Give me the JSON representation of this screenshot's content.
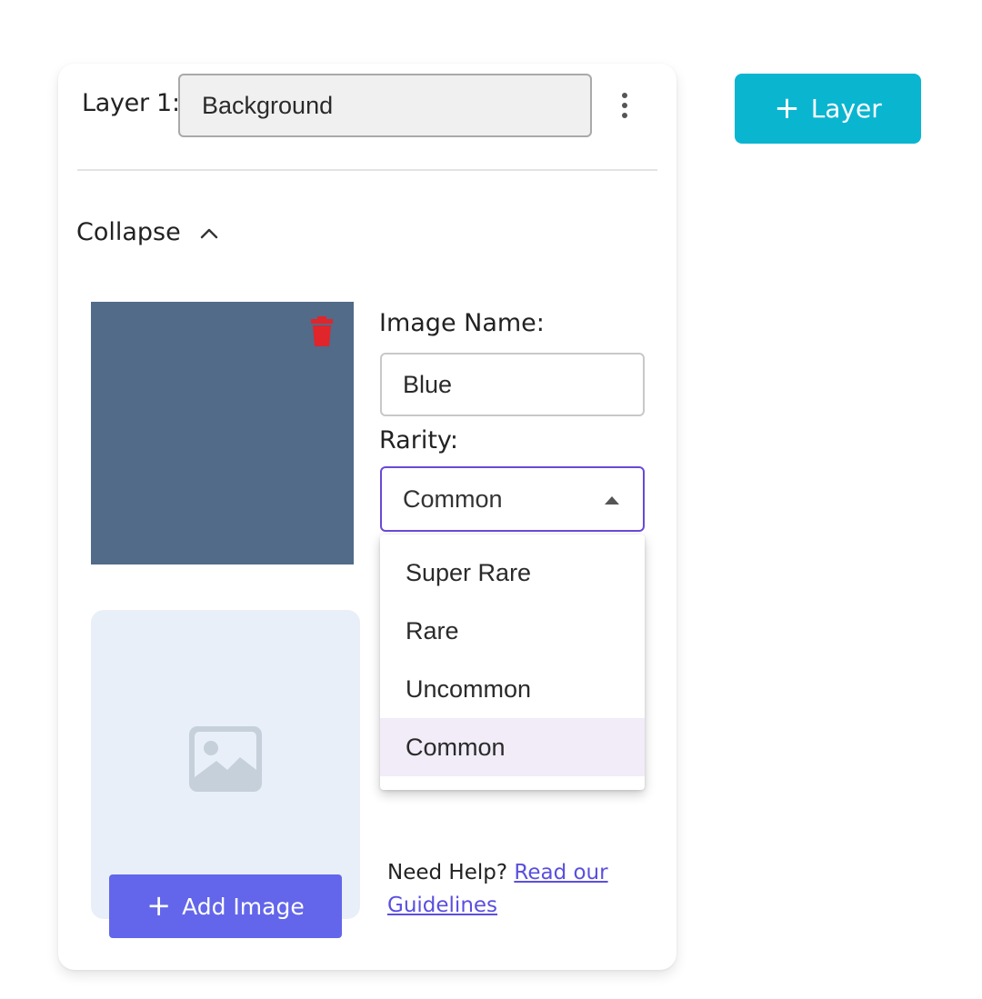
{
  "layer": {
    "label": "Layer 1:",
    "name_value": "Background",
    "menu_icon": "kebab-menu-icon"
  },
  "collapse": {
    "label": "Collapse",
    "icon": "chevron-up-icon"
  },
  "image_item": {
    "swatch_color": "#516b89",
    "delete_icon": "trash-icon",
    "name_label": "Image Name:",
    "name_value": "Blue",
    "rarity_label": "Rarity:",
    "rarity_value": "Common",
    "rarity_options": [
      "Super Rare",
      "Rare",
      "Uncommon",
      "Common"
    ],
    "selected_option": "Common"
  },
  "upload": {
    "placeholder_icon": "image-placeholder-icon",
    "button_plus": "+",
    "button_label": "Add Image"
  },
  "help": {
    "text": "Need Help?",
    "link_text": "Read our Guidelines"
  },
  "toolbar": {
    "add_layer_plus": "+",
    "add_layer_label": "Layer"
  },
  "colors": {
    "accent_cyan": "#0ab5d0",
    "accent_indigo": "#6366ea",
    "select_focus": "#6a49d8",
    "delete_red": "#e0252b"
  }
}
